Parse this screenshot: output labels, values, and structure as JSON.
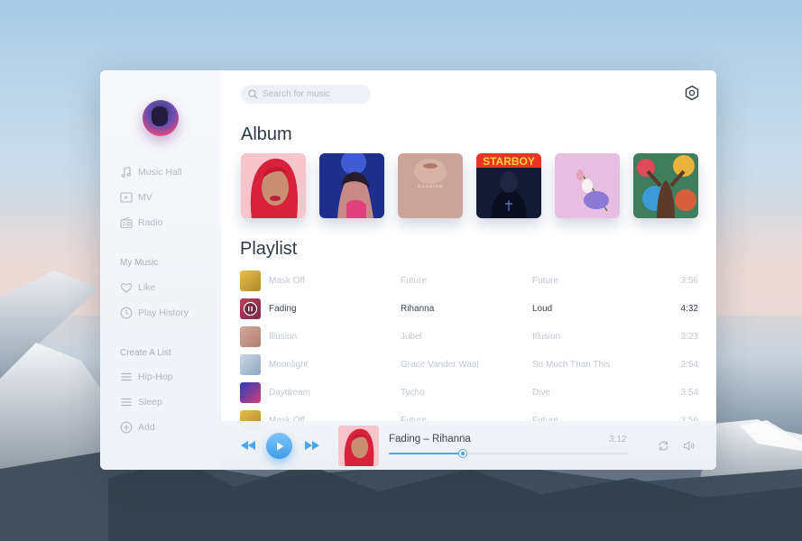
{
  "sidebar": {
    "nav": [
      {
        "label": "Music Hall",
        "icon": "music-note-icon"
      },
      {
        "label": "MV",
        "icon": "video-icon"
      },
      {
        "label": "Radio",
        "icon": "radio-icon"
      }
    ],
    "my_music_heading": "My Music",
    "my_music": [
      {
        "label": "Like",
        "icon": "heart-icon"
      },
      {
        "label": "Play History",
        "icon": "clock-icon"
      }
    ],
    "create_list_heading": "Create A List",
    "lists": [
      {
        "label": "Hip-Hop",
        "icon": "list-icon"
      },
      {
        "label": "Sleep",
        "icon": "list-icon"
      },
      {
        "label": "Add",
        "icon": "plus-circle-icon"
      }
    ]
  },
  "search": {
    "placeholder": "Search for music",
    "icon": "search-icon"
  },
  "settings_icon": "settings-hexagon-icon",
  "album_section": {
    "title": "Album"
  },
  "playlist_section": {
    "title": "Playlist"
  },
  "playlist": [
    {
      "title": "Mask Off",
      "artist": "Future",
      "album": "Future",
      "duration": "3:56"
    },
    {
      "title": "Fading",
      "artist": "Rihanna",
      "album": "Loud",
      "duration": "4:32",
      "playing": true
    },
    {
      "title": "Illusion",
      "artist": "Jubel",
      "album": "Illusion",
      "duration": "3:23"
    },
    {
      "title": "Moonlight",
      "artist": "Grace Vander Waal",
      "album": "So Much Than This",
      "duration": "2:54"
    },
    {
      "title": "Daydream",
      "artist": "Tycho",
      "album": "Dive",
      "duration": "3:54"
    },
    {
      "title": "Mask Off",
      "artist": "Future",
      "album": "Future",
      "duration": "3:56"
    }
  ],
  "album_cover_texts": {
    "illusion": "ILLUSION",
    "starboy": "STARBOY"
  },
  "player": {
    "now_playing": "Fading – Rihanna",
    "time": "3:12",
    "progress": 0.31,
    "accent_color": "#49a6ee"
  }
}
